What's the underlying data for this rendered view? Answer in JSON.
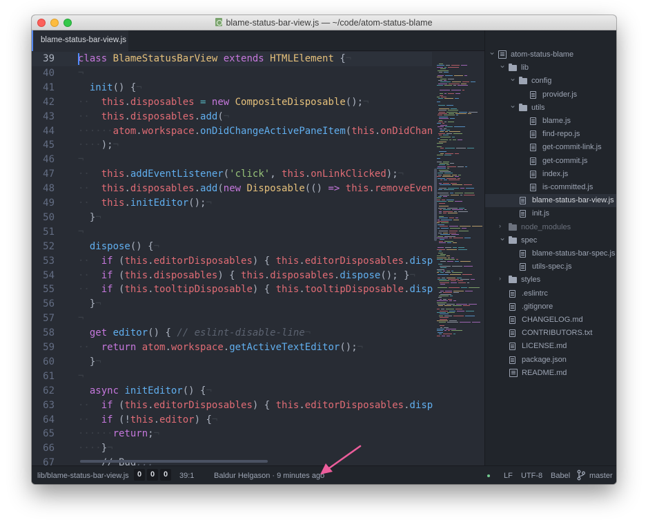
{
  "window": {
    "title": "blame-status-bar-view.js — ~/code/atom-status-blame",
    "title_icon": "javascript-file-icon"
  },
  "tab": {
    "label": "blame-status-bar-view.js"
  },
  "editor": {
    "cursor_line": "39",
    "lines": [
      {
        "n": "39",
        "tokens": [
          {
            "t": "class ",
            "c": "kw"
          },
          {
            "t": "BlameStatusBarView ",
            "c": "cls"
          },
          {
            "t": "extends ",
            "c": "kw"
          },
          {
            "t": "HTMLElement",
            "c": "cls"
          },
          {
            "t": " {"
          },
          {
            "t": "¬",
            "c": "inv"
          }
        ]
      },
      {
        "n": "40",
        "tokens": [
          {
            "t": "¬",
            "c": "inv"
          }
        ]
      },
      {
        "n": "41",
        "tokens": [
          {
            "t": "  "
          },
          {
            "t": "init",
            "c": "fn"
          },
          {
            "t": "() {"
          },
          {
            "t": "¬",
            "c": "inv"
          }
        ]
      },
      {
        "n": "42",
        "tokens": [
          {
            "t": "··",
            "c": "inv"
          },
          {
            "t": "  "
          },
          {
            "t": "this",
            "c": "th"
          },
          {
            "t": "."
          },
          {
            "t": "disposables",
            "c": "th"
          },
          {
            "t": " = ",
            "c": "op"
          },
          {
            "t": "new ",
            "c": "kw"
          },
          {
            "t": "CompositeDisposable",
            "c": "cls"
          },
          {
            "t": "();"
          },
          {
            "t": "¬",
            "c": "inv"
          }
        ]
      },
      {
        "n": "43",
        "tokens": [
          {
            "t": "··",
            "c": "inv"
          },
          {
            "t": "  "
          },
          {
            "t": "this",
            "c": "th"
          },
          {
            "t": "."
          },
          {
            "t": "disposables",
            "c": "th"
          },
          {
            "t": "."
          },
          {
            "t": "add",
            "c": "fn"
          },
          {
            "t": "("
          },
          {
            "t": "¬",
            "c": "inv"
          }
        ]
      },
      {
        "n": "44",
        "tokens": [
          {
            "t": "······",
            "c": "inv"
          },
          {
            "t": "atom",
            "c": "th"
          },
          {
            "t": "."
          },
          {
            "t": "workspace",
            "c": "th"
          },
          {
            "t": "."
          },
          {
            "t": "onDidChangeActivePaneItem",
            "c": "fn"
          },
          {
            "t": "("
          },
          {
            "t": "this",
            "c": "th"
          },
          {
            "t": "."
          },
          {
            "t": "onDidChange",
            "c": "th"
          }
        ]
      },
      {
        "n": "45",
        "tokens": [
          {
            "t": "····",
            "c": "inv"
          },
          {
            "t": ");"
          },
          {
            "t": "¬",
            "c": "inv"
          }
        ]
      },
      {
        "n": "46",
        "tokens": [
          {
            "t": "¬",
            "c": "inv"
          }
        ]
      },
      {
        "n": "47",
        "tokens": [
          {
            "t": "··",
            "c": "inv"
          },
          {
            "t": "  "
          },
          {
            "t": "this",
            "c": "th"
          },
          {
            "t": "."
          },
          {
            "t": "addEventListener",
            "c": "fn"
          },
          {
            "t": "("
          },
          {
            "t": "'click'",
            "c": "str"
          },
          {
            "t": ", "
          },
          {
            "t": "this",
            "c": "th"
          },
          {
            "t": "."
          },
          {
            "t": "onLinkClicked",
            "c": "th"
          },
          {
            "t": ");"
          },
          {
            "t": "¬",
            "c": "inv"
          }
        ]
      },
      {
        "n": "48",
        "tokens": [
          {
            "t": "··",
            "c": "inv"
          },
          {
            "t": "  "
          },
          {
            "t": "this",
            "c": "th"
          },
          {
            "t": "."
          },
          {
            "t": "disposables",
            "c": "th"
          },
          {
            "t": "."
          },
          {
            "t": "add",
            "c": "fn"
          },
          {
            "t": "("
          },
          {
            "t": "new ",
            "c": "kw"
          },
          {
            "t": "Disposable",
            "c": "cls"
          },
          {
            "t": "(() "
          },
          {
            "t": "=> ",
            "c": "kw"
          },
          {
            "t": "this",
            "c": "th"
          },
          {
            "t": "."
          },
          {
            "t": "removeEvent",
            "c": "th"
          }
        ]
      },
      {
        "n": "49",
        "tokens": [
          {
            "t": "··",
            "c": "inv"
          },
          {
            "t": "  "
          },
          {
            "t": "this",
            "c": "th"
          },
          {
            "t": "."
          },
          {
            "t": "initEditor",
            "c": "fn"
          },
          {
            "t": "();"
          },
          {
            "t": "¬",
            "c": "inv"
          }
        ]
      },
      {
        "n": "50",
        "tokens": [
          {
            "t": "  }"
          },
          {
            "t": "¬",
            "c": "inv"
          }
        ]
      },
      {
        "n": "51",
        "tokens": [
          {
            "t": "¬",
            "c": "inv"
          }
        ]
      },
      {
        "n": "52",
        "tokens": [
          {
            "t": "  "
          },
          {
            "t": "dispose",
            "c": "fn"
          },
          {
            "t": "() {"
          },
          {
            "t": "¬",
            "c": "inv"
          }
        ]
      },
      {
        "n": "53",
        "tokens": [
          {
            "t": "··",
            "c": "inv"
          },
          {
            "t": "  "
          },
          {
            "t": "if ",
            "c": "kw"
          },
          {
            "t": "("
          },
          {
            "t": "this",
            "c": "th"
          },
          {
            "t": "."
          },
          {
            "t": "editorDisposables",
            "c": "th"
          },
          {
            "t": ") { "
          },
          {
            "t": "this",
            "c": "th"
          },
          {
            "t": "."
          },
          {
            "t": "editorDisposables",
            "c": "th"
          },
          {
            "t": "."
          },
          {
            "t": "dispo",
            "c": "fn"
          }
        ]
      },
      {
        "n": "54",
        "tokens": [
          {
            "t": "··",
            "c": "inv"
          },
          {
            "t": "  "
          },
          {
            "t": "if ",
            "c": "kw"
          },
          {
            "t": "("
          },
          {
            "t": "this",
            "c": "th"
          },
          {
            "t": "."
          },
          {
            "t": "disposables",
            "c": "th"
          },
          {
            "t": ") { "
          },
          {
            "t": "this",
            "c": "th"
          },
          {
            "t": "."
          },
          {
            "t": "disposables",
            "c": "th"
          },
          {
            "t": "."
          },
          {
            "t": "dispose",
            "c": "fn"
          },
          {
            "t": "(); }"
          },
          {
            "t": "¬",
            "c": "inv"
          }
        ]
      },
      {
        "n": "55",
        "tokens": [
          {
            "t": "··",
            "c": "inv"
          },
          {
            "t": "  "
          },
          {
            "t": "if ",
            "c": "kw"
          },
          {
            "t": "("
          },
          {
            "t": "this",
            "c": "th"
          },
          {
            "t": "."
          },
          {
            "t": "tooltipDisposable",
            "c": "th"
          },
          {
            "t": ") { "
          },
          {
            "t": "this",
            "c": "th"
          },
          {
            "t": "."
          },
          {
            "t": "tooltipDisposable",
            "c": "th"
          },
          {
            "t": "."
          },
          {
            "t": "dispo",
            "c": "fn"
          }
        ]
      },
      {
        "n": "56",
        "tokens": [
          {
            "t": "  }"
          },
          {
            "t": "¬",
            "c": "inv"
          }
        ]
      },
      {
        "n": "57",
        "tokens": [
          {
            "t": "¬",
            "c": "inv"
          }
        ]
      },
      {
        "n": "58",
        "tokens": [
          {
            "t": "  "
          },
          {
            "t": "get ",
            "c": "kw"
          },
          {
            "t": "editor",
            "c": "fn"
          },
          {
            "t": "() { "
          },
          {
            "t": "// eslint-disable-line",
            "c": "cm"
          },
          {
            "t": "¬",
            "c": "inv"
          }
        ]
      },
      {
        "n": "59",
        "tokens": [
          {
            "t": "··",
            "c": "inv"
          },
          {
            "t": "  "
          },
          {
            "t": "return ",
            "c": "kw"
          },
          {
            "t": "atom",
            "c": "th"
          },
          {
            "t": "."
          },
          {
            "t": "workspace",
            "c": "th"
          },
          {
            "t": "."
          },
          {
            "t": "getActiveTextEditor",
            "c": "fn"
          },
          {
            "t": "();"
          },
          {
            "t": "¬",
            "c": "inv"
          }
        ]
      },
      {
        "n": "60",
        "tokens": [
          {
            "t": "  }"
          },
          {
            "t": "¬",
            "c": "inv"
          }
        ]
      },
      {
        "n": "61",
        "tokens": [
          {
            "t": "¬",
            "c": "inv"
          }
        ]
      },
      {
        "n": "62",
        "tokens": [
          {
            "t": "  "
          },
          {
            "t": "async ",
            "c": "kw"
          },
          {
            "t": "initEditor",
            "c": "fn"
          },
          {
            "t": "() {"
          },
          {
            "t": "¬",
            "c": "inv"
          }
        ]
      },
      {
        "n": "63",
        "tokens": [
          {
            "t": "··",
            "c": "inv"
          },
          {
            "t": "  "
          },
          {
            "t": "if ",
            "c": "kw"
          },
          {
            "t": "("
          },
          {
            "t": "this",
            "c": "th"
          },
          {
            "t": "."
          },
          {
            "t": "editorDisposables",
            "c": "th"
          },
          {
            "t": ") { "
          },
          {
            "t": "this",
            "c": "th"
          },
          {
            "t": "."
          },
          {
            "t": "editorDisposables",
            "c": "th"
          },
          {
            "t": "."
          },
          {
            "t": "dispo",
            "c": "fn"
          }
        ]
      },
      {
        "n": "64",
        "tokens": [
          {
            "t": "··",
            "c": "inv"
          },
          {
            "t": "  "
          },
          {
            "t": "if ",
            "c": "kw"
          },
          {
            "t": "(!"
          },
          {
            "t": "this",
            "c": "th"
          },
          {
            "t": "."
          },
          {
            "t": "editor",
            "c": "th"
          },
          {
            "t": ") {"
          },
          {
            "t": "¬",
            "c": "inv"
          }
        ]
      },
      {
        "n": "65",
        "tokens": [
          {
            "t": "······",
            "c": "inv"
          },
          {
            "t": "return",
            "c": "kw"
          },
          {
            "t": ";"
          },
          {
            "t": "¬",
            "c": "inv"
          }
        ]
      },
      {
        "n": "66",
        "tokens": [
          {
            "t": "····",
            "c": "inv"
          },
          {
            "t": "}"
          },
          {
            "t": "¬",
            "c": "inv"
          }
        ]
      },
      {
        "n": "67",
        "tokens": [
          {
            "t": "····",
            "c": "inv"
          },
          {
            "t": "// Bug"
          },
          {
            "t": "...",
            "c": "cm"
          }
        ]
      }
    ]
  },
  "tree": {
    "items": [
      {
        "label": "atom-status-blame",
        "type": "repo",
        "depth": 0,
        "chev": "down"
      },
      {
        "label": "lib",
        "type": "dir",
        "depth": 1,
        "chev": "down"
      },
      {
        "label": "config",
        "type": "dir",
        "depth": 2,
        "chev": "down"
      },
      {
        "label": "provider.js",
        "type": "file",
        "depth": 3
      },
      {
        "label": "utils",
        "type": "dir",
        "depth": 2,
        "chev": "down"
      },
      {
        "label": "blame.js",
        "type": "file",
        "depth": 3
      },
      {
        "label": "find-repo.js",
        "type": "file",
        "depth": 3
      },
      {
        "label": "get-commit-link.js",
        "type": "file",
        "depth": 3
      },
      {
        "label": "get-commit.js",
        "type": "file",
        "depth": 3
      },
      {
        "label": "index.js",
        "type": "file",
        "depth": 3
      },
      {
        "label": "is-committed.js",
        "type": "file",
        "depth": 3
      },
      {
        "label": "blame-status-bar-view.js",
        "type": "file",
        "depth": 2,
        "selected": true
      },
      {
        "label": "init.js",
        "type": "file",
        "depth": 2
      },
      {
        "label": "node_modules",
        "type": "dir",
        "depth": 1,
        "chev": "right",
        "dim": true
      },
      {
        "label": "spec",
        "type": "dir",
        "depth": 1,
        "chev": "down"
      },
      {
        "label": "blame-status-bar-spec.js",
        "type": "file",
        "depth": 2
      },
      {
        "label": "utils-spec.js",
        "type": "file",
        "depth": 2
      },
      {
        "label": "styles",
        "type": "dir",
        "depth": 1,
        "chev": "right"
      },
      {
        "label": ".eslintrc",
        "type": "file",
        "depth": 1
      },
      {
        "label": ".gitignore",
        "type": "file",
        "depth": 1
      },
      {
        "label": "CHANGELOG.md",
        "type": "file",
        "depth": 1
      },
      {
        "label": "CONTRIBUTORS.txt",
        "type": "file",
        "depth": 1
      },
      {
        "label": "LICENSE.md",
        "type": "file",
        "depth": 1
      },
      {
        "label": "package.json",
        "type": "file",
        "depth": 1
      },
      {
        "label": "README.md",
        "type": "readme",
        "depth": 1
      }
    ]
  },
  "statusbar": {
    "file_path": "lib/blame-status-bar-view.js",
    "counts": [
      "0",
      "0",
      "0"
    ],
    "cursor_position": "39:1",
    "blame": "Baldur Helgason · 9 minutes ago",
    "line_ending": "LF",
    "encoding": "UTF-8",
    "grammar": "Babel",
    "branch": "master",
    "branch_icon": "git-branch-icon"
  },
  "annotation": {
    "icon": "pink-arrow-icon",
    "color": "#ec5d9b"
  }
}
